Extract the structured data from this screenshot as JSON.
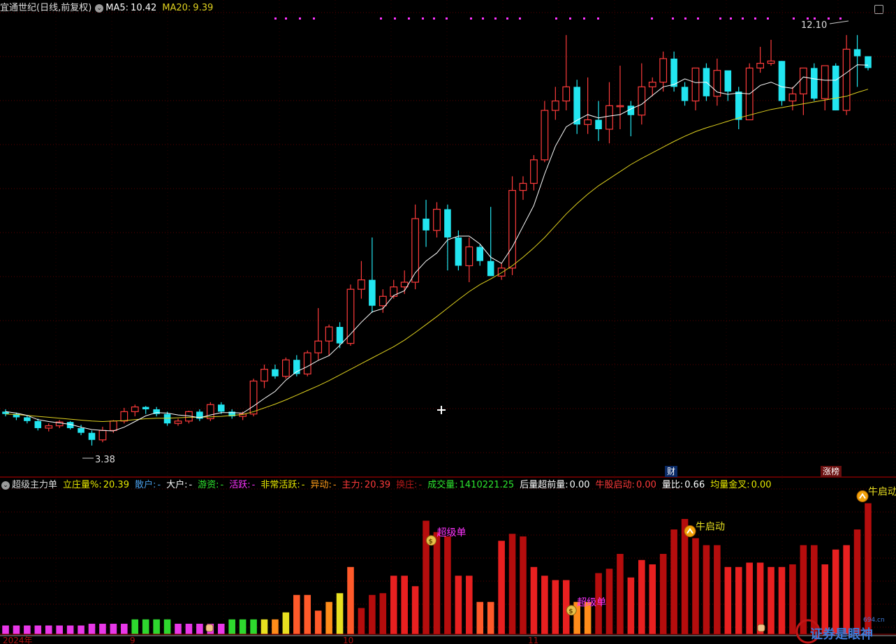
{
  "header": {
    "stock": "宜通世纪(日线,前复权)",
    "ma5_label": "MA5:",
    "ma5_value": "10.42",
    "ma20_label": "MA20:",
    "ma20_value": "9.39"
  },
  "price_annotations": {
    "high": "12.10",
    "low": "3.38"
  },
  "event_tags": {
    "finance": "财",
    "limit_up_list": "涨榜"
  },
  "indicator_header": {
    "name": "超级主力单",
    "items": [
      {
        "label": "立庄量%:",
        "value": "20.39",
        "color": "#e8e800"
      },
      {
        "label": "散户:",
        "value": "-",
        "color": "#4a9de8"
      },
      {
        "label": "大户:",
        "value": "-",
        "color": "#ffffff"
      },
      {
        "label": "游资:",
        "value": "-",
        "color": "#2ee52e"
      },
      {
        "label": "活跃:",
        "value": "-",
        "color": "#ff33ff"
      },
      {
        "label": "非常活跃:",
        "value": "-",
        "color": "#e8e800"
      },
      {
        "label": "异动:",
        "value": "-",
        "color": "#ff9a1a"
      },
      {
        "label": "主力:",
        "value": "20.39",
        "color": "#ff3a3a"
      },
      {
        "label": "换庄:",
        "value": "-",
        "color": "#b01818"
      },
      {
        "label": "成交量:",
        "value": "1410221.25",
        "color": "#2ee52e"
      },
      {
        "label": "后量超前量:",
        "value": "0.00",
        "color": "#ffffff"
      },
      {
        "label": "牛股启动:",
        "value": "0.00",
        "color": "#ff3a3a"
      },
      {
        "label": "量比:",
        "value": "0.66",
        "color": "#ffffff"
      },
      {
        "label": "均量金叉:",
        "value": "0.00",
        "color": "#e8e800"
      }
    ]
  },
  "signals": {
    "super_order": "超级单",
    "bull_start": "牛启动"
  },
  "watermark": "证券是眼神",
  "watermark_site": "694.cn",
  "time_labels": [
    "2024年",
    "9",
    "10",
    "11"
  ],
  "colors": {
    "up": "#ff3b3b",
    "down": "#22e5f0",
    "ma5": "#ffffff",
    "ma20": "#e0d21f",
    "magenta": "#ff33ff",
    "grid": "#7a0000"
  },
  "chart_data": {
    "type": "candlestick",
    "series_names": [
      "MA5",
      "MA20"
    ],
    "ohlc": [
      [
        4.1,
        4.15,
        4.0,
        4.05
      ],
      [
        4.05,
        4.08,
        3.92,
        3.98
      ],
      [
        3.98,
        4.02,
        3.85,
        3.9
      ],
      [
        3.9,
        3.95,
        3.7,
        3.75
      ],
      [
        3.75,
        3.85,
        3.68,
        3.8
      ],
      [
        3.8,
        3.92,
        3.75,
        3.88
      ],
      [
        3.88,
        3.9,
        3.72,
        3.75
      ],
      [
        3.75,
        3.82,
        3.6,
        3.65
      ],
      [
        3.65,
        3.7,
        3.38,
        3.5
      ],
      [
        3.5,
        3.78,
        3.45,
        3.7
      ],
      [
        3.7,
        3.92,
        3.65,
        3.9
      ],
      [
        3.9,
        4.18,
        3.85,
        4.1
      ],
      [
        4.1,
        4.25,
        4.0,
        4.2
      ],
      [
        4.2,
        4.22,
        4.05,
        4.15
      ],
      [
        4.15,
        4.2,
        4.0,
        4.05
      ],
      [
        4.05,
        4.1,
        3.8,
        3.85
      ],
      [
        3.85,
        3.95,
        3.8,
        3.9
      ],
      [
        3.9,
        4.12,
        3.85,
        4.1
      ],
      [
        4.1,
        4.15,
        3.9,
        3.95
      ],
      [
        3.95,
        4.3,
        3.9,
        4.25
      ],
      [
        4.25,
        4.3,
        4.05,
        4.1
      ],
      [
        4.1,
        4.15,
        3.95,
        4.0
      ],
      [
        4.0,
        4.1,
        3.92,
        4.05
      ],
      [
        4.05,
        4.8,
        4.0,
        4.75
      ],
      [
        4.75,
        5.1,
        4.6,
        5.0
      ],
      [
        5.0,
        5.1,
        4.8,
        4.85
      ],
      [
        4.85,
        5.25,
        4.8,
        5.2
      ],
      [
        5.2,
        5.3,
        4.85,
        4.9
      ],
      [
        4.9,
        5.4,
        4.85,
        5.35
      ],
      [
        5.35,
        6.3,
        5.2,
        5.6
      ],
      [
        5.6,
        5.95,
        5.3,
        5.9
      ],
      [
        5.9,
        6.0,
        5.45,
        5.55
      ],
      [
        5.55,
        6.8,
        5.5,
        6.7
      ],
      [
        6.7,
        7.3,
        6.5,
        6.9
      ],
      [
        6.9,
        7.8,
        6.2,
        6.35
      ],
      [
        6.35,
        6.7,
        6.2,
        6.55
      ],
      [
        6.55,
        6.9,
        6.5,
        6.75
      ],
      [
        6.75,
        7.1,
        6.6,
        6.85
      ],
      [
        6.85,
        8.5,
        6.7,
        8.2
      ],
      [
        8.2,
        8.6,
        7.6,
        7.95
      ],
      [
        7.95,
        8.55,
        7.8,
        8.4
      ],
      [
        8.4,
        8.5,
        7.1,
        7.8
      ],
      [
        7.8,
        7.95,
        7.1,
        7.2
      ],
      [
        7.2,
        7.8,
        6.85,
        7.6
      ],
      [
        7.6,
        7.65,
        7.2,
        7.3
      ],
      [
        7.3,
        8.45,
        6.98,
        6.98
      ],
      [
        6.98,
        7.25,
        6.9,
        7.15
      ],
      [
        7.15,
        9.1,
        7.0,
        8.8
      ],
      [
        8.8,
        9.1,
        8.6,
        8.95
      ],
      [
        8.95,
        9.55,
        8.8,
        9.45
      ],
      [
        9.45,
        10.7,
        9.4,
        10.5
      ],
      [
        10.5,
        11.0,
        10.3,
        10.7
      ],
      [
        10.7,
        12.1,
        10.5,
        11.0
      ],
      [
        11.0,
        11.15,
        10.0,
        10.2
      ],
      [
        10.2,
        11.2,
        10.0,
        10.3
      ],
      [
        10.3,
        10.7,
        9.85,
        10.1
      ],
      [
        10.1,
        11.1,
        9.8,
        10.6
      ],
      [
        10.6,
        11.45,
        10.1,
        10.6
      ],
      [
        10.6,
        10.7,
        9.95,
        10.4
      ],
      [
        10.4,
        11.5,
        10.2,
        11.0
      ],
      [
        11.0,
        11.2,
        10.8,
        11.1
      ],
      [
        11.1,
        11.75,
        10.9,
        11.6
      ],
      [
        11.6,
        11.75,
        10.9,
        11.0
      ],
      [
        11.0,
        11.1,
        10.6,
        10.7
      ],
      [
        10.7,
        11.3,
        10.5,
        11.4
      ],
      [
        11.4,
        11.5,
        10.7,
        10.8
      ],
      [
        10.8,
        11.6,
        10.6,
        11.35
      ],
      [
        11.35,
        11.0,
        10.7,
        10.9
      ],
      [
        10.9,
        11.0,
        10.1,
        10.3
      ],
      [
        10.3,
        11.5,
        10.3,
        11.4
      ],
      [
        11.4,
        11.85,
        11.3,
        11.5
      ],
      [
        11.5,
        12.0,
        11.45,
        11.55
      ],
      [
        11.55,
        11.55,
        10.6,
        10.7
      ],
      [
        10.7,
        11.0,
        10.5,
        10.85
      ],
      [
        10.85,
        11.4,
        10.4,
        11.4
      ],
      [
        11.4,
        11.5,
        10.7,
        10.75
      ],
      [
        10.75,
        11.45,
        10.5,
        11.45
      ],
      [
        11.45,
        11.5,
        10.5,
        10.5
      ],
      [
        10.5,
        12.1,
        10.4,
        11.8
      ],
      [
        11.8,
        12.1,
        11.0,
        11.65
      ],
      [
        11.65,
        11.65,
        11.35,
        11.4
      ]
    ],
    "ma5": [
      4.1,
      4.07,
      4.02,
      3.93,
      3.89,
      3.86,
      3.83,
      3.77,
      3.72,
      3.7,
      3.69,
      3.77,
      3.89,
      4.01,
      4.08,
      4.07,
      4.03,
      4.01,
      3.97,
      4.03,
      4.08,
      4.08,
      4.07,
      4.22,
      4.38,
      4.53,
      4.77,
      4.95,
      5.06,
      5.19,
      5.29,
      5.51,
      5.75,
      6.0,
      6.22,
      6.29,
      6.57,
      6.67,
      7.05,
      7.3,
      7.47,
      7.75,
      7.83,
      7.83,
      7.66,
      7.38,
      7.25,
      7.6,
      8.04,
      8.48,
      9.15,
      9.74,
      10.15,
      10.29,
      10.41,
      10.34,
      10.38,
      10.41,
      10.53,
      10.63,
      10.82,
      11.0,
      11.05,
      11.17,
      11.09,
      11.1,
      10.89,
      10.84,
      10.87,
      10.85,
      11.03,
      11.1,
      11.0,
      10.97,
      11.21,
      11.17,
      11.14,
      11.14,
      11.3,
      11.47,
      11.46
    ],
    "ma20": [
      4.05,
      4.04,
      4.02,
      4.0,
      3.98,
      3.96,
      3.94,
      3.92,
      3.9,
      3.89,
      3.9,
      3.91,
      3.93,
      3.95,
      3.96,
      3.96,
      3.97,
      3.98,
      3.98,
      3.99,
      4.0,
      4.02,
      4.04,
      4.1,
      4.18,
      4.26,
      4.35,
      4.45,
      4.55,
      4.65,
      4.76,
      4.88,
      5.0,
      5.12,
      5.24,
      5.36,
      5.48,
      5.62,
      5.78,
      5.95,
      6.12,
      6.3,
      6.48,
      6.65,
      6.8,
      6.92,
      7.05,
      7.2,
      7.38,
      7.58,
      7.8,
      8.05,
      8.3,
      8.52,
      8.72,
      8.9,
      9.05,
      9.2,
      9.35,
      9.48,
      9.6,
      9.72,
      9.84,
      9.95,
      10.05,
      10.13,
      10.2,
      10.27,
      10.34,
      10.4,
      10.46,
      10.52,
      10.56,
      10.6,
      10.64,
      10.68,
      10.72,
      10.76,
      10.8,
      10.88,
      10.95
    ],
    "volume": [
      10,
      10,
      10,
      10,
      10,
      10,
      10,
      10,
      12,
      12,
      12,
      12,
      17,
      17,
      17,
      17,
      12,
      12,
      12,
      12,
      12,
      17,
      17,
      17,
      17,
      17,
      25,
      45,
      45,
      27,
      37,
      47,
      77,
      30,
      45,
      47,
      67,
      67,
      55,
      130,
      117,
      112,
      67,
      67,
      37,
      37,
      107,
      115,
      112,
      77,
      67,
      62,
      62,
      37,
      37,
      70,
      75,
      92,
      65,
      85,
      80,
      92,
      120,
      132,
      110,
      102,
      102,
      77,
      77,
      82,
      82,
      77,
      77,
      80,
      102,
      102,
      80,
      97,
      102,
      120,
      150
    ],
    "volume_level": [
      0,
      0,
      0,
      0,
      0,
      0,
      0,
      0,
      0,
      0,
      0,
      0,
      1,
      1,
      1,
      1,
      0,
      0,
      0,
      0,
      0,
      1,
      1,
      1,
      2,
      3,
      2,
      4,
      4,
      4,
      3,
      2,
      4,
      6,
      6,
      6,
      5,
      5,
      5,
      6,
      6,
      6,
      5,
      5,
      4,
      4,
      5,
      6,
      6,
      5,
      5,
      5,
      5,
      3,
      3,
      6,
      6,
      6,
      5,
      5,
      5,
      6,
      6,
      6,
      6,
      6,
      6,
      5,
      5,
      5,
      5,
      5,
      5,
      6,
      6,
      6,
      5,
      5,
      5,
      6,
      6
    ],
    "signals": [
      {
        "type": "超级单",
        "bar": 40
      },
      {
        "type": "超级单",
        "bar": 53
      },
      {
        "type": "牛启动",
        "bar": 64
      },
      {
        "type": "牛启动",
        "bar": 80
      }
    ],
    "ylim": [
      3.2,
      12.4
    ]
  }
}
